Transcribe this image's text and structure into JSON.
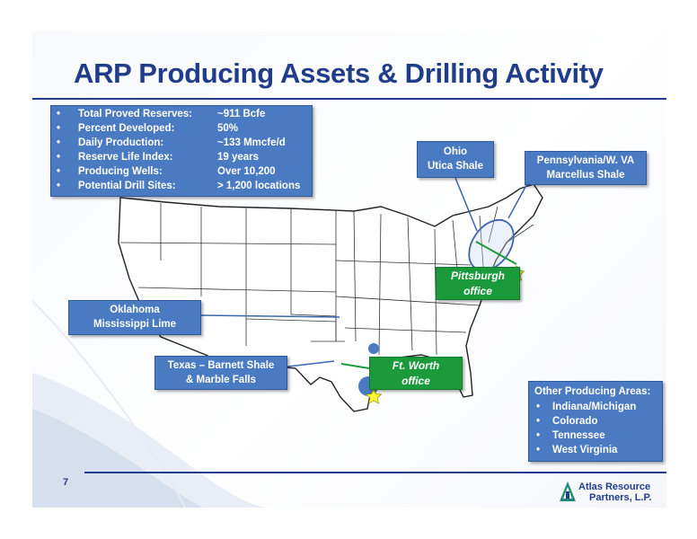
{
  "title": "ARP Producing Assets & Drilling Activity",
  "page_number": "7",
  "stats": [
    {
      "label": "Total Proved Reserves:",
      "value": "~911 Bcfe"
    },
    {
      "label": "Percent Developed:",
      "value": "50%"
    },
    {
      "label": "Daily Production:",
      "value": "~133 Mmcfe/d"
    },
    {
      "label": "Reserve Life Index:",
      "value": " 19 years"
    },
    {
      "label": "Producing Wells:",
      "value": " Over 10,200"
    },
    {
      "label": "Potential Drill Sites:",
      "value": "> 1,200 locations"
    }
  ],
  "bullet": "•",
  "callouts": {
    "ohio": {
      "line1": "Ohio",
      "line2": "Utica Shale"
    },
    "pennsylvania": {
      "line1": "Pennsylvania/W. VA",
      "line2": "Marcellus Shale"
    },
    "oklahoma": {
      "line1": "Oklahoma",
      "line2": "Mississippi Lime"
    },
    "texas": {
      "line1": "Texas – Barnett Shale",
      "line2": "& Marble Falls"
    }
  },
  "offices": {
    "pittsburgh": {
      "line1": "Pittsburgh",
      "line2": "office"
    },
    "ft_worth": {
      "line1": "Ft. Worth",
      "line2": "office"
    }
  },
  "other_areas": {
    "title": "Other Producing Areas:",
    "items": [
      "Indiana/Michigan",
      "Colorado",
      "Tennessee",
      "West Virginia"
    ]
  },
  "logo": {
    "line1": "Atlas Resource",
    "line2": "Partners, L.P."
  },
  "colors": {
    "title_blue": "#1f3d8a",
    "box_blue": "#4a7ac2",
    "office_green": "#1b9a3c",
    "star_yellow": "#ffff33"
  }
}
